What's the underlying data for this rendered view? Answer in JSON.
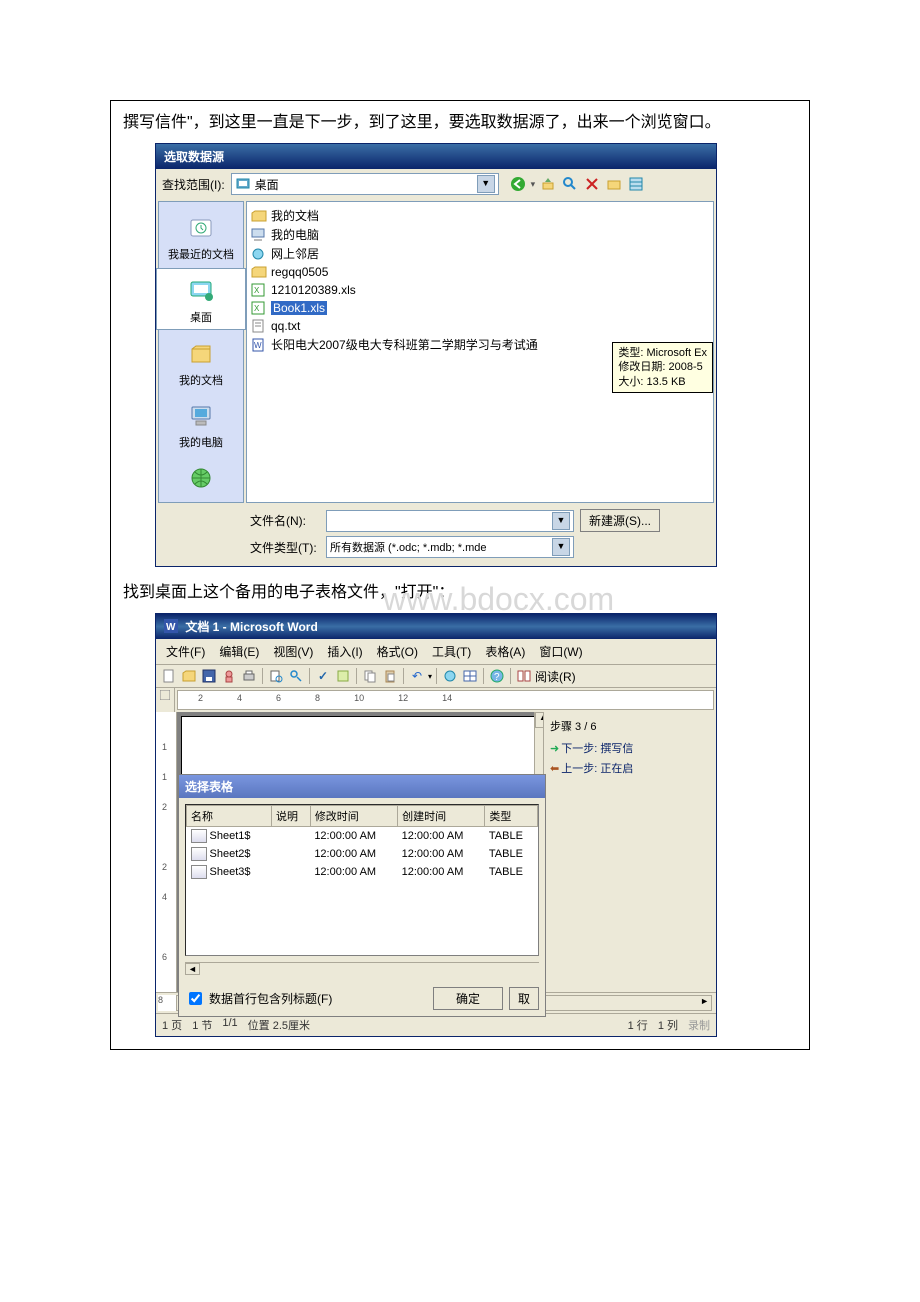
{
  "para1": "撰写信件\"，到这里一直是下一步，到了这里，要选取数据源了，出来一个浏览窗口。",
  "para2": "找到桌面上这个备用的电子表格文件，\"打开\"：",
  "watermark": "www.bdocx.com",
  "dlg1": {
    "title": "选取数据源",
    "lookin_label": "查找范围(I):",
    "lookin_value": "桌面",
    "places": [
      "我最近的文档",
      "桌面",
      "我的文档",
      "我的电脑"
    ],
    "files": [
      {
        "icon": "folder",
        "name": "我的文档"
      },
      {
        "icon": "computer",
        "name": "我的电脑"
      },
      {
        "icon": "network",
        "name": "网上邻居"
      },
      {
        "icon": "folder",
        "name": "regqq0505"
      },
      {
        "icon": "xls",
        "name": "1210120389.xls"
      },
      {
        "icon": "xls",
        "name": "Book1.xls",
        "selected": true
      },
      {
        "icon": "txt",
        "name": "qq.txt"
      },
      {
        "icon": "doc",
        "name": "长阳电大2007级电大专科班第二学期学习与考试通"
      }
    ],
    "tooltip_type": "类型: Microsoft Ex",
    "tooltip_date": "修改日期: 2008-5",
    "tooltip_size": "大小: 13.5 KB",
    "filename_label": "文件名(N):",
    "filetype_label": "文件类型(T):",
    "filetype_value": "所有数据源 (*.odc; *.mdb; *.mde",
    "newsource_btn": "新建源(S)..."
  },
  "word": {
    "title": "文档 1 - Microsoft Word",
    "menu": [
      "文件(F)",
      "编辑(E)",
      "视图(V)",
      "插入(I)",
      "格式(O)",
      "工具(T)",
      "表格(A)",
      "窗口(W)"
    ],
    "read_btn": "阅读(R)",
    "seltbl": {
      "title": "选择表格",
      "cols": [
        "名称",
        "说明",
        "修改时间",
        "创建时间",
        "类型"
      ],
      "rows": [
        {
          "name": "Sheet1$",
          "desc": "",
          "mod": "12:00:00 AM",
          "crt": "12:00:00 AM",
          "type": "TABLE"
        },
        {
          "name": "Sheet2$",
          "desc": "",
          "mod": "12:00:00 AM",
          "crt": "12:00:00 AM",
          "type": "TABLE"
        },
        {
          "name": "Sheet3$",
          "desc": "",
          "mod": "12:00:00 AM",
          "crt": "12:00:00 AM",
          "type": "TABLE"
        }
      ],
      "checkbox": "数据首行包含列标题(F)",
      "ok": "确定",
      "cancel": "取"
    },
    "pane": {
      "step": "步骤 3 / 6",
      "next": "下一步: 撰写信",
      "prev": "上一步: 正在启"
    },
    "status": {
      "page": "1 页",
      "sec": "1 节",
      "pp": "1/1",
      "pos": "位置 2.5厘米",
      "ln": "1 行",
      "col": "1 列",
      "rec": "录制"
    }
  }
}
